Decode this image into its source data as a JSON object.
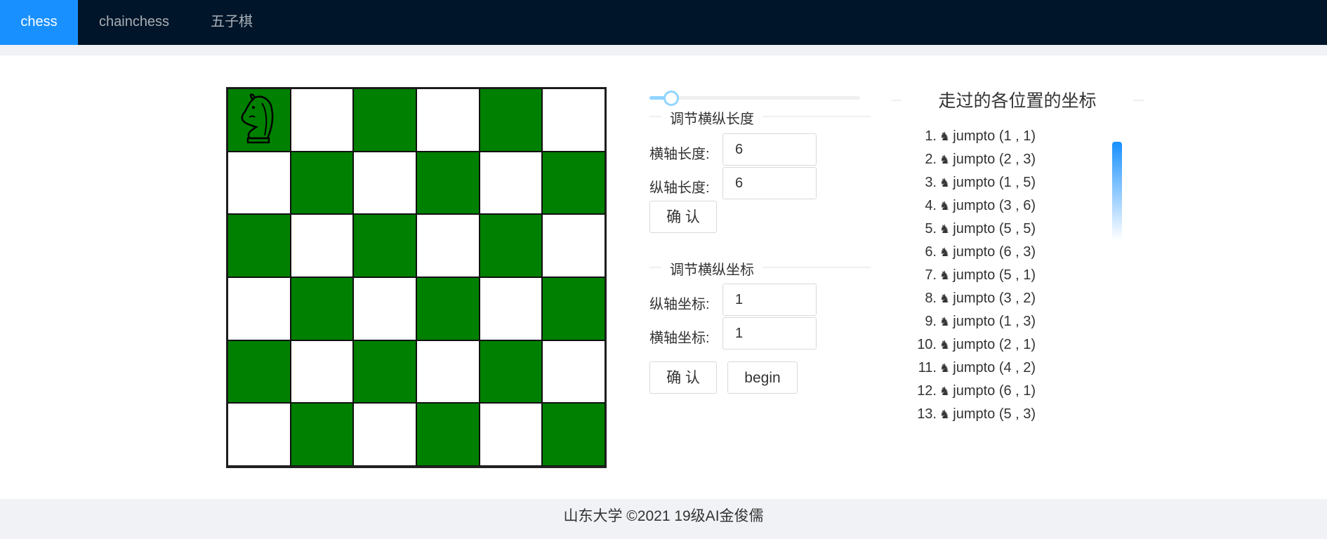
{
  "nav": {
    "items": [
      {
        "label": "chess",
        "active": true
      },
      {
        "label": "chainchess",
        "active": false
      },
      {
        "label": "五子棋",
        "active": false
      }
    ]
  },
  "board": {
    "size": 6,
    "light_color": "#ffffff",
    "dark_color": "#008000",
    "knight_piece": "knight-icon"
  },
  "slider": {
    "value": 2
  },
  "size_section": {
    "title": "调节横纵长度",
    "x_label": "横轴长度:",
    "x_value": "6",
    "y_label": "纵轴长度:",
    "y_value": "6",
    "confirm_label": "确 认"
  },
  "coord_section": {
    "title": "调节横纵坐标",
    "y_label": "纵轴坐标:",
    "y_value": "1",
    "x_label": "横轴坐标:",
    "x_value": "1",
    "confirm_label": "确 认",
    "begin_label": "begin"
  },
  "history": {
    "title": "走过的各位置的坐标",
    "items": [
      {
        "num": "1.",
        "text": "jumpto (1 , 1)"
      },
      {
        "num": "2.",
        "text": "jumpto (2 , 3)"
      },
      {
        "num": "3.",
        "text": "jumpto (1 , 5)"
      },
      {
        "num": "4.",
        "text": "jumpto (3 , 6)"
      },
      {
        "num": "5.",
        "text": "jumpto (5 , 5)"
      },
      {
        "num": "6.",
        "text": "jumpto (6 , 3)"
      },
      {
        "num": "7.",
        "text": "jumpto (5 , 1)"
      },
      {
        "num": "8.",
        "text": "jumpto (3 , 2)"
      },
      {
        "num": "9.",
        "text": "jumpto (1 , 3)"
      },
      {
        "num": "10.",
        "text": "jumpto (2 , 1)"
      },
      {
        "num": "11.",
        "text": "jumpto (4 , 2)"
      },
      {
        "num": "12.",
        "text": "jumpto (6 , 1)"
      },
      {
        "num": "13.",
        "text": "jumpto (5 , 3)"
      }
    ]
  },
  "footer": {
    "text": "山东大学 ©2021 19级AI金俊儒"
  }
}
